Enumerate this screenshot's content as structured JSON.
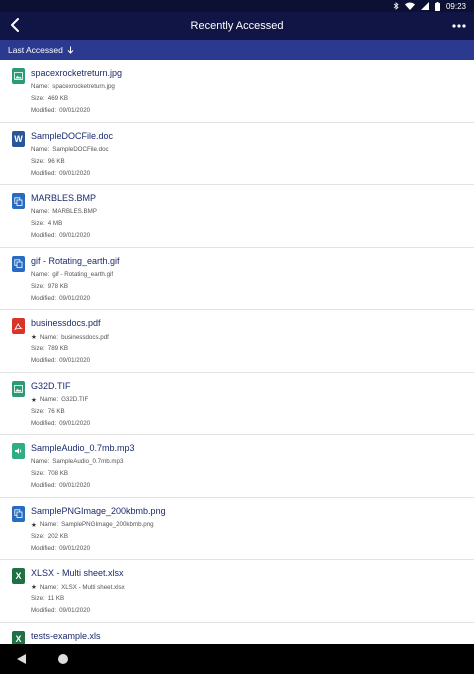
{
  "status": {
    "time": "09:23"
  },
  "header": {
    "title": "Recently Accessed"
  },
  "sort": {
    "label": "Last Accessed"
  },
  "colors": {
    "header_bg": "#101545",
    "sortbar_bg": "#2b3a8f",
    "link": "#1b2a6b"
  },
  "labels": {
    "name": "Name:",
    "size": "Size:",
    "modified": "Modified:"
  },
  "files": [
    {
      "title": "spacexrocketreturn.jpg",
      "name": "spacexrocketreturn.jpg",
      "size": "469 KB",
      "modified": "09/01/2020",
      "icon": "image-file-icon",
      "starred": false
    },
    {
      "title": "SampleDOCFile.doc",
      "name": "SampleDOCFile.doc",
      "size": "96 KB",
      "modified": "09/01/2020",
      "icon": "word-file-icon",
      "starred": false
    },
    {
      "title": "MARBLES.BMP",
      "name": "MARBLES.BMP",
      "size": "4 MB",
      "modified": "09/01/2020",
      "icon": "generic-file-icon",
      "starred": false
    },
    {
      "title": "gif - Rotating_earth.gif",
      "name": "gif - Rotating_earth.gif",
      "size": "978 KB",
      "modified": "09/01/2020",
      "icon": "generic-file-icon",
      "starred": false
    },
    {
      "title": "businessdocs.pdf",
      "name": "businessdocs.pdf",
      "size": "789 KB",
      "modified": "09/01/2020",
      "icon": "pdf-file-icon",
      "starred": true
    },
    {
      "title": "G32D.TIF",
      "name": "G32D.TIF",
      "size": "76 KB",
      "modified": "09/01/2020",
      "icon": "image-file-icon",
      "starred": true
    },
    {
      "title": "SampleAudio_0.7mb.mp3",
      "name": "SampleAudio_0.7mb.mp3",
      "size": "708 KB",
      "modified": "09/01/2020",
      "icon": "audio-file-icon",
      "starred": false
    },
    {
      "title": "SamplePNGImage_200kbmb.png",
      "name": "SamplePNGImage_200kbmb.png",
      "size": "202 KB",
      "modified": "09/01/2020",
      "icon": "generic-file-icon",
      "starred": true
    },
    {
      "title": "XLSX - Multi sheet.xlsx",
      "name": "XLSX - Multi sheet.xlsx",
      "size": "11 KB",
      "modified": "09/01/2020",
      "icon": "excel-file-icon",
      "starred": true
    },
    {
      "title": "tests-example.xls",
      "name": "",
      "size": "",
      "modified": "",
      "icon": "excel-file-icon",
      "starred": false
    }
  ]
}
